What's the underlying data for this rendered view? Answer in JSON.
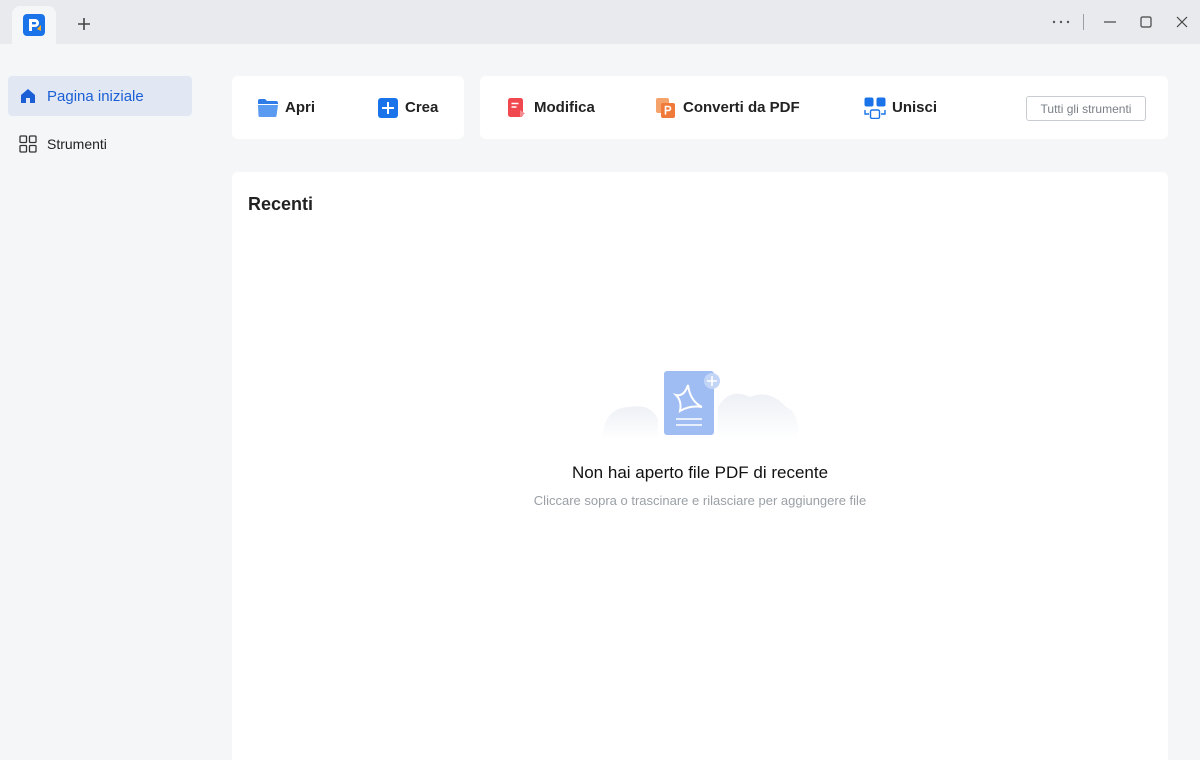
{
  "titlebar": {
    "app_icon": "pdf-app-logo-icon",
    "new_tab_icon": "plus-icon",
    "more_icon": "more-dots-icon",
    "minimize_icon": "minimize-icon",
    "maximize_icon": "maximize-icon",
    "close_icon": "close-icon"
  },
  "sidebar": {
    "items": [
      {
        "label": "Pagina iniziale",
        "icon": "home-icon",
        "active": true
      },
      {
        "label": "Strumenti",
        "icon": "grid-icon",
        "active": false
      }
    ]
  },
  "quick_actions": {
    "open": "Apri",
    "create": "Crea",
    "edit": "Modifica",
    "convert": "Converti da PDF",
    "merge": "Unisci",
    "all_tools": "Tutti gli strumenti"
  },
  "recent": {
    "title": "Recenti",
    "empty_title": "Non hai aperto file PDF di recente",
    "empty_subtitle": "Cliccare sopra o trascinare e rilasciare per aggiungere file"
  },
  "colors": {
    "accent": "#1a5fd6",
    "active_bg": "#e1e8f3",
    "edit_red": "#f0484e",
    "convert_orange": "#f07a3a"
  }
}
